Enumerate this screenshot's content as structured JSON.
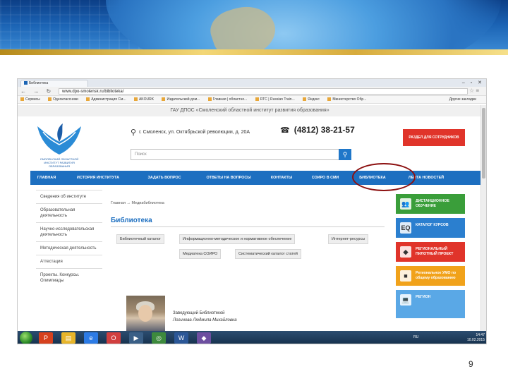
{
  "slide": {
    "page_number": "9"
  },
  "browser": {
    "tab_title": "Библиотека",
    "url": "www.dpo-smolensk.ru/biblioteka/",
    "bookmarks": [
      "Сервисы",
      "Одноклассники",
      "Администрация См...",
      "AKOURK",
      "Издательский дом...",
      "Главная | областно...",
      "RTC | Russian Train...",
      "Яндекс",
      "Министерство Обр..."
    ],
    "other_bookmarks": "Другие закладки"
  },
  "site": {
    "top_title": "ГАУ ДПОС «Смоленский областной институт развития образования»",
    "logo_text": "СМОЛЕНСКИЙ ОБЛАСТНОЙ ИНСТИТУТ РАЗВИТИЯ ОБРАЗОВАНИЯ",
    "address": "г. Смоленск, ул. Октябрьской революции, д. 20А",
    "phone": "(4812) 38-21-57",
    "staff_button": "РАЗДЕЛ ДЛЯ СОТРУДНИКОВ",
    "search_placeholder": "Поиск",
    "nav": [
      "ГЛАВНАЯ",
      "ИСТОРИЯ ИНСТИТУТА",
      "ЗАДАТЬ ВОПРОС",
      "ОТВЕТЫ НА ВОПРОСЫ",
      "КОНТАКТЫ",
      "СОИРО В СМИ",
      "БИБЛИОТЕКА",
      "ЛЕНТА НОВОСТЕЙ"
    ],
    "sidebar": [
      "Сведения об институте",
      "Образовательная деятельность",
      "Научно-исследовательская деятельность",
      "Методическая деятельность",
      "Аттестация",
      "Проекты. Конкурсы. Олимпиады"
    ],
    "breadcrumb": "Главная → Медиабиблиотека",
    "page_title": "Библиотека",
    "subtabs": [
      "Библиотечный каталог",
      "Информационно-методическое и нормативное обеспечение",
      "Интернет-ресурсы",
      "Медиатека СОИРО",
      "Систематический каталог статей"
    ],
    "person_role": "Заведующий Библиотекой",
    "person_name": "Логинова Людмила Михайловна",
    "right_buttons": [
      {
        "label": "ДИСТАНЦИОННОЕ ОБУЧЕНИЕ",
        "color": "#3a9e3a",
        "icon": "👥"
      },
      {
        "label": "КАТАЛОГ КУРСОВ",
        "color": "#2b7fcf",
        "icon": "EQ"
      },
      {
        "label": "РЕГИОНАЛЬНЫЙ ПИЛОТНЫЙ ПРОЕКТ",
        "color": "#e0342a",
        "icon": "◆"
      },
      {
        "label": "Региональное УМО по общему образованию",
        "color": "#f1a21a",
        "icon": "■"
      },
      {
        "label": "РЕГИОН",
        "color": "#5aa8e6",
        "icon": "💻"
      }
    ]
  },
  "taskbar": {
    "lang": "RU",
    "time": "14:47",
    "date": "10.02.2015"
  }
}
